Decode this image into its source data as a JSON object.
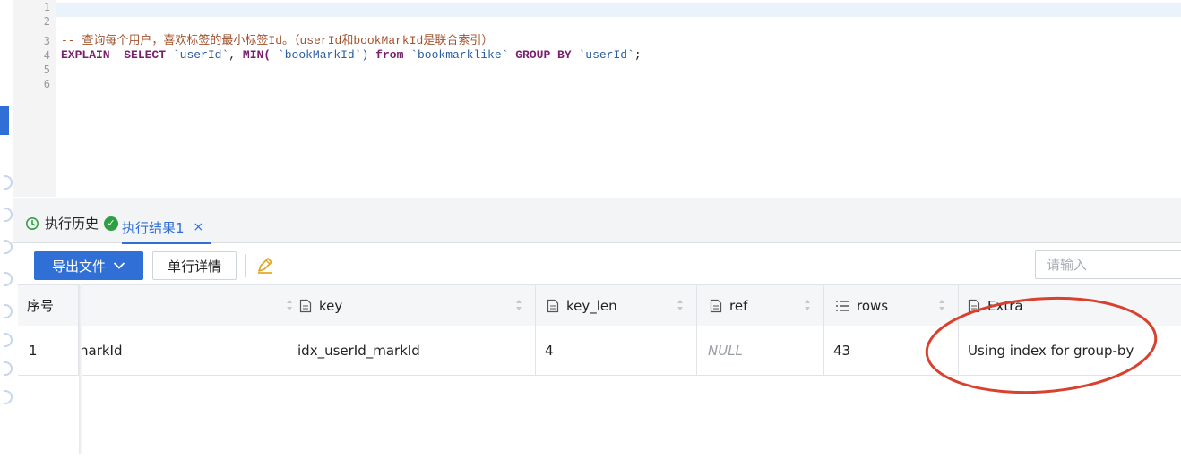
{
  "editor": {
    "line_numbers": [
      "1",
      "2",
      "3",
      "4",
      "5",
      "6"
    ],
    "comment": "-- 查询每个用户，喜欢标签的最小标签Id。（userId和bookMarkId是联合索引）",
    "sql": {
      "kw1": "EXPLAIN",
      "kw2": "SELECT",
      "col1": "`userId`",
      "comma": ",",
      "fn": "MIN(",
      "col2": "`bookMarkId`",
      "paren": ")",
      "kw3": "from",
      "table": "`bookmarklike`",
      "kw4": "GROUP BY",
      "col3": "`userId`",
      "end": ";"
    }
  },
  "tabs": {
    "history_label": "执行历史",
    "result_label": "执行结果1",
    "close_symbol": "×"
  },
  "toolbar": {
    "export_label": "导出文件",
    "detail_label": "单行详情",
    "search_placeholder": "请输入"
  },
  "table": {
    "headers": {
      "index": "序号",
      "key": "key",
      "key_len": "key_len",
      "ref": "ref",
      "rows": "rows",
      "extra": "Extra"
    },
    "row": {
      "index": "1",
      "possible_keys": "narkId",
      "key": "idx_userId_markId",
      "key_len": "4",
      "ref": "NULL",
      "rows": "43",
      "extra": "Using index for group-by"
    }
  },
  "colors": {
    "accent": "#2f6fd6",
    "success": "#2ea043",
    "annotation": "#d9412f"
  }
}
